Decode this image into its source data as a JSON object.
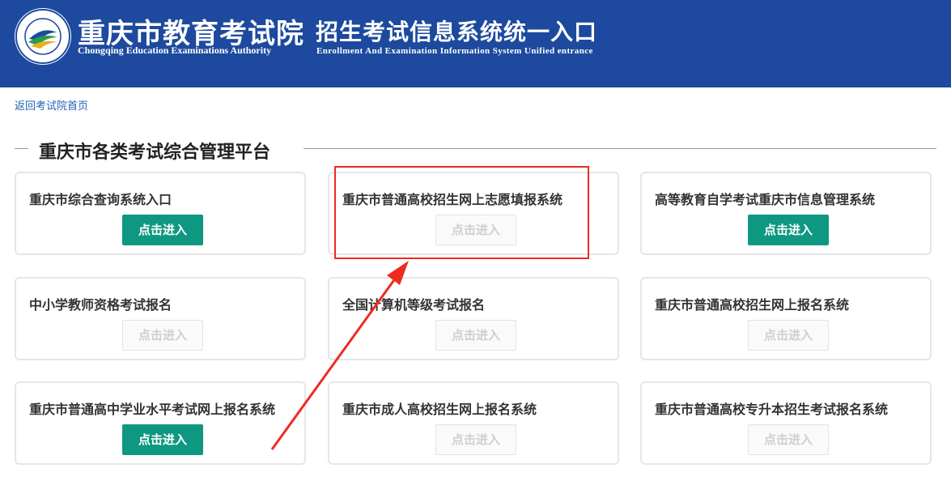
{
  "header": {
    "logo": {
      "icon": "authority-logo-icon",
      "text": "重庆市教育考试院 Chongqing Education Examinations Authority"
    },
    "org_name_cn": "重庆市教育考试院",
    "org_name_en": "Chongqing Education Examinations Authority",
    "system_title_cn": "招生考试信息系统统一入口",
    "system_title_en": "Enrollment And Examination Information System Unified entrance",
    "background_color": "#1d4a9e"
  },
  "back_link": "返回考试院首页",
  "section_title": "重庆市各类考试综合管理平台",
  "colors": {
    "button_active": "#0f9881",
    "button_disabled_text": "#cfcfcf",
    "highlight": "#ee2b22"
  },
  "cards": [
    {
      "title": "重庆市综合查询系统入口",
      "button": "点击进入",
      "enabled": true
    },
    {
      "title": "重庆市普通高校招生网上志愿填报系统",
      "button": "点击进入",
      "enabled": false
    },
    {
      "title": "高等教育自学考试重庆市信息管理系统",
      "button": "点击进入",
      "enabled": true
    },
    {
      "title": "中小学教师资格考试报名",
      "button": "点击进入",
      "enabled": false
    },
    {
      "title": "全国计算机等级考试报名",
      "button": "点击进入",
      "enabled": false
    },
    {
      "title": "重庆市普通高校招生网上报名系统",
      "button": "点击进入",
      "enabled": false
    },
    {
      "title": "重庆市普通高中学业水平考试网上报名系统",
      "button": "点击进入",
      "enabled": true
    },
    {
      "title": "重庆市成人高校招生网上报名系统",
      "button": "点击进入",
      "enabled": false
    },
    {
      "title": "重庆市普通高校专升本招生考试报名系统",
      "button": "点击进入",
      "enabled": false
    }
  ]
}
